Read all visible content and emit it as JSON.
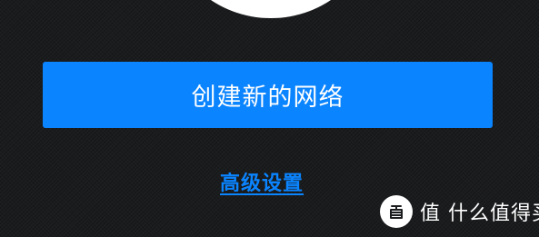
{
  "create_button": {
    "label": "创建新的网络"
  },
  "advanced_link": {
    "label": "高级设置"
  },
  "watermark": {
    "text": "值 什么值得买",
    "logo_icon": "zhi-logo-icon"
  },
  "colors": {
    "background": "#1b1c1e",
    "accent": "#0a84ff",
    "text": "#ffffff"
  }
}
